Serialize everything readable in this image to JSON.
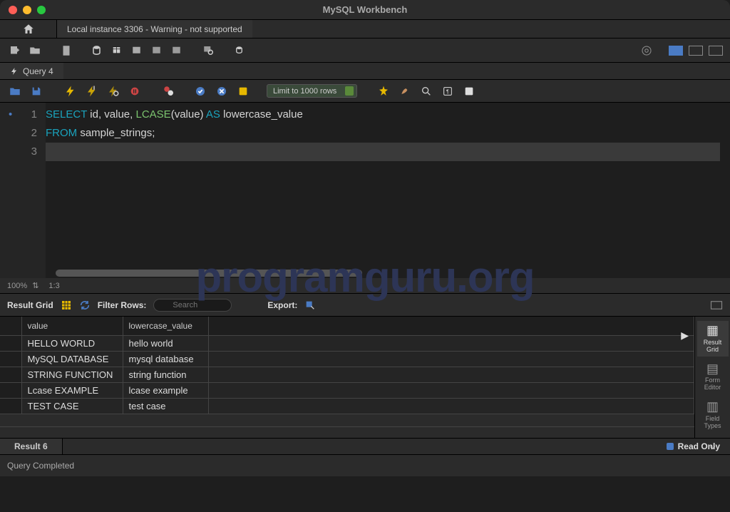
{
  "window": {
    "title": "MySQL Workbench"
  },
  "connection_tab": "Local instance 3306 - Warning - not supported",
  "query_tab": "Query 4",
  "limit": "Limit to 1000 rows",
  "sql": {
    "line1_parts": [
      "SELECT",
      " id",
      ",",
      " value",
      ",",
      " ",
      "LCASE",
      "(",
      "value",
      ")",
      " ",
      "AS",
      " lowercase_value"
    ],
    "line2_parts": [
      "FROM",
      " sample_strings",
      ";"
    ]
  },
  "zoom": {
    "percent": "100%",
    "pos": "1:3"
  },
  "result_toolbar": {
    "title": "Result Grid",
    "filter_label": "Filter Rows:",
    "filter_placeholder": "Search",
    "export_label": "Export:"
  },
  "columns": [
    "",
    "value",
    "lowercase_value",
    ""
  ],
  "rows": [
    {
      "value": "HELLO WORLD",
      "lowercase_value": "hello world"
    },
    {
      "value": "MySQL DATABASE",
      "lowercase_value": "mysql database"
    },
    {
      "value": "STRING FUNCTION",
      "lowercase_value": "string function"
    },
    {
      "value": "Lcase EXAMPLE",
      "lowercase_value": "lcase example"
    },
    {
      "value": "TEST CASE",
      "lowercase_value": "test case"
    }
  ],
  "side_tabs": {
    "result_grid": "Result\nGrid",
    "form_editor": "Form\nEditor",
    "field_types": "Field\nTypes"
  },
  "result_tab": "Result 6",
  "readonly": "Read Only",
  "status": "Query Completed",
  "watermark": "programguru.org"
}
